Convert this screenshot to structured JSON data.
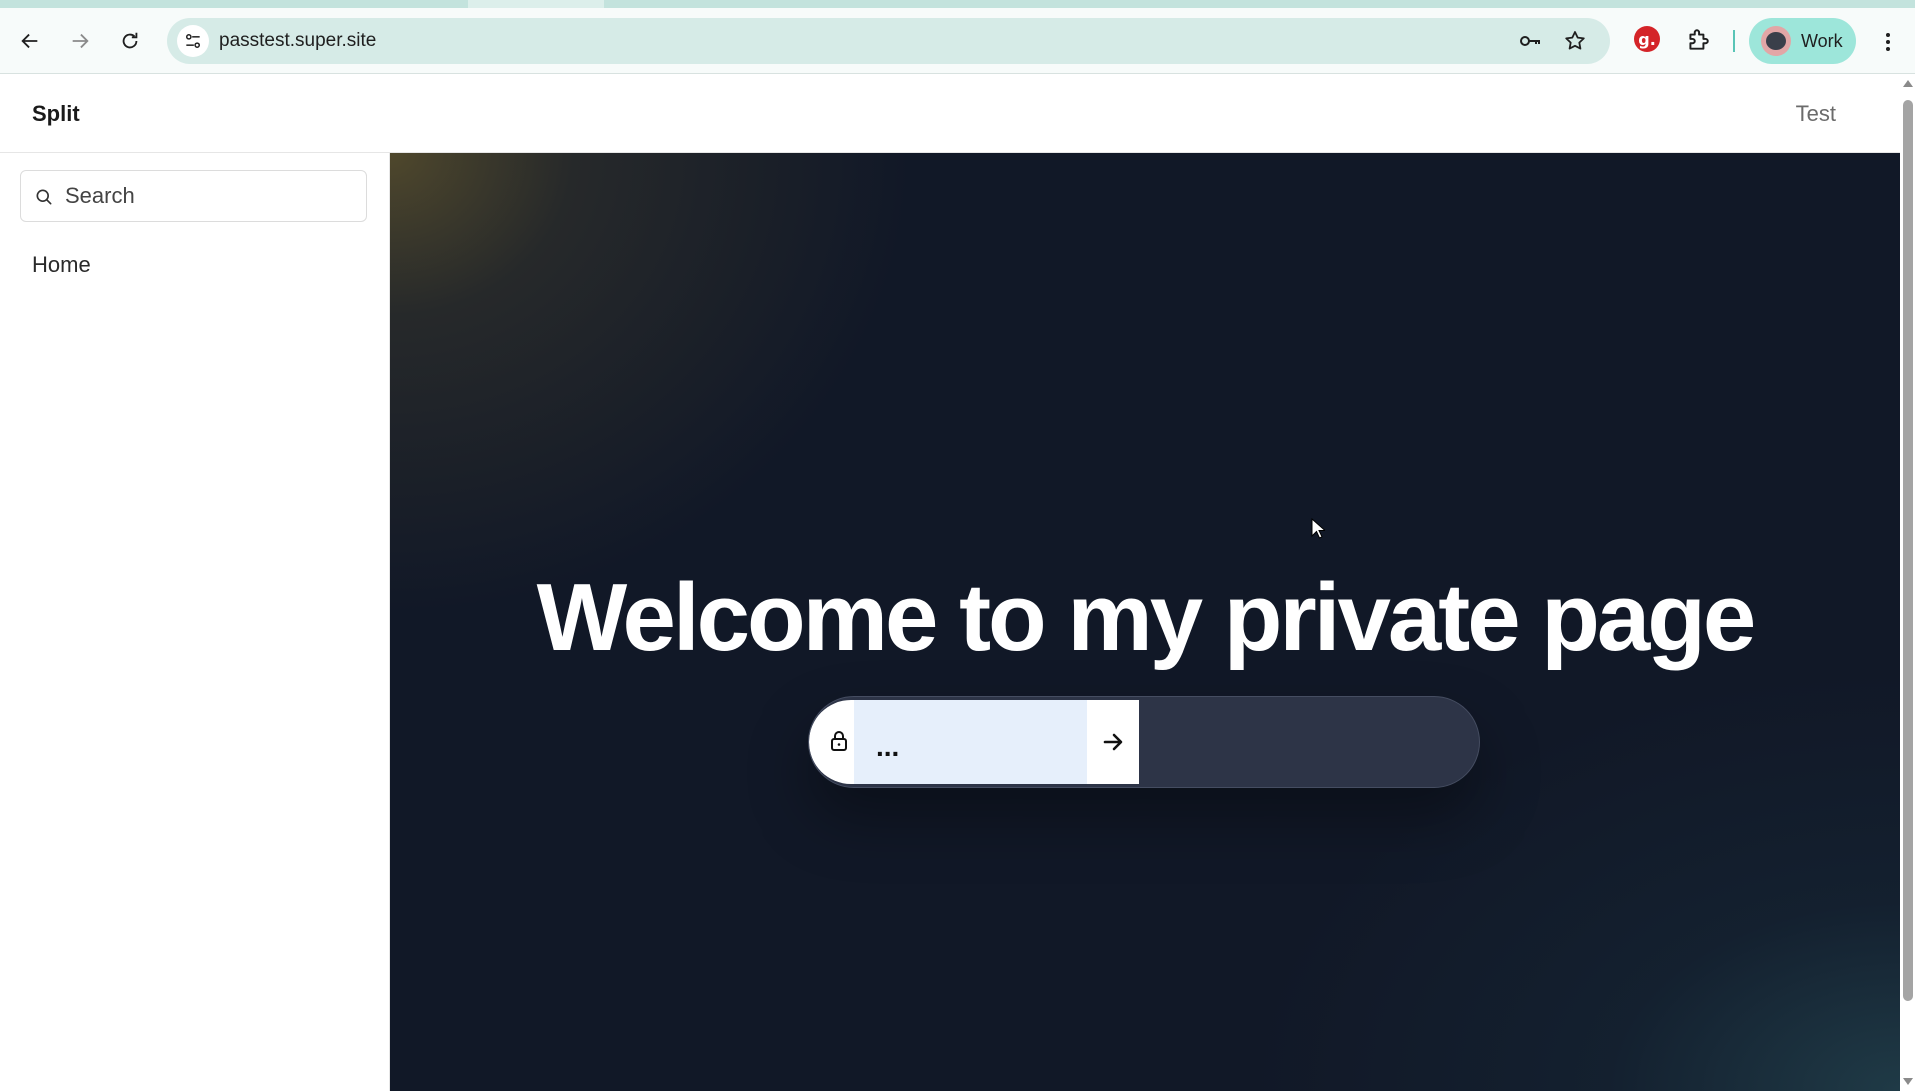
{
  "browser": {
    "url": "passtest.super.site",
    "profile_label": "Work",
    "extension_badge": "g.",
    "icons": [
      "back-icon",
      "forward-icon",
      "reload-icon",
      "site-info-icon",
      "password-key-icon",
      "bookmark-star-icon",
      "extensions-puzzle-icon",
      "kebab-menu-icon"
    ]
  },
  "header": {
    "site_title": "Split",
    "nav_link": "Test"
  },
  "sidebar": {
    "search_placeholder": "Search",
    "items": [
      {
        "label": "Home"
      }
    ]
  },
  "hero": {
    "title": "Welcome to my private page",
    "password_value": "..."
  },
  "colors": {
    "hero_bg": "#111827",
    "form_bg": "#2d3447",
    "input_bg": "#e6effb",
    "omnibox_bg": "#d6ebe7",
    "profile_chip_bg": "#9de6da"
  }
}
